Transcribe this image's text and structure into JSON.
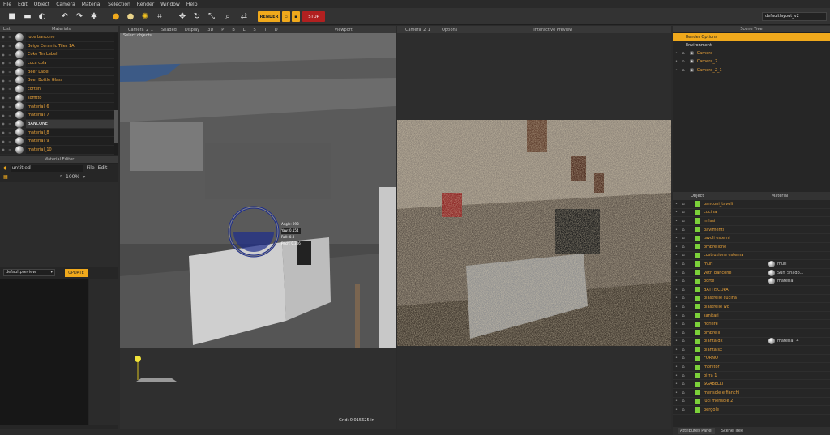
{
  "menu": [
    "File",
    "Edit",
    "Object",
    "Camera",
    "Material",
    "Selection",
    "Render",
    "Window",
    "Help"
  ],
  "toolbar": {
    "render_label": "RENDER",
    "stop_label": "STOP",
    "layout": "defaultlayout_v2"
  },
  "materials_panel": {
    "tabs": [
      "List",
      "Materials"
    ],
    "items": [
      {
        "name": "luce bancone",
        "sel": false
      },
      {
        "name": "Beige Ceramic Tiles 1A",
        "sel": false
      },
      {
        "name": "Coke Tin Label",
        "sel": false
      },
      {
        "name": "coca cola",
        "sel": false
      },
      {
        "name": "Beer Label",
        "sel": false
      },
      {
        "name": "Beer Bottle Glass",
        "sel": false
      },
      {
        "name": "corten",
        "sel": false
      },
      {
        "name": "soffitto",
        "sel": false
      },
      {
        "name": "material_6",
        "sel": false
      },
      {
        "name": "material_7",
        "sel": false
      },
      {
        "name": "BANCONE",
        "sel": true
      },
      {
        "name": "material_8",
        "sel": false
      },
      {
        "name": "material_9",
        "sel": false
      },
      {
        "name": "material_10",
        "sel": false
      }
    ]
  },
  "material_editor": {
    "title": "Material Editor",
    "name": "untitled",
    "menu": [
      "File",
      "Edit"
    ],
    "zoom": "100%",
    "preview": "defaultpreview",
    "update_label": "UPDATE"
  },
  "viewport": {
    "title": "Viewport",
    "camera": "Camera_2_1",
    "menus": [
      "Shaded",
      "Display",
      "3D",
      "P",
      "B",
      "L",
      "S",
      "T",
      "D"
    ],
    "hint": "Select objects",
    "grid": "Grid: 0.015625 in",
    "gizmo": {
      "angle": "Angle: 298",
      "yaw": "Yaw: 0.154",
      "roll": "Roll: 0.0",
      "pitch": "Pitch: 0.306"
    }
  },
  "interactive": {
    "title": "Interactive Preview",
    "camera": "Camera_2_1",
    "options": "Options"
  },
  "scene_tree": {
    "title": "Scene Tree",
    "render_options": "Render Options",
    "environment": "Environment",
    "cameras": [
      "Camera",
      "Camera_2",
      "Camera_2_1"
    ],
    "col_object": "Object",
    "col_material": "Material",
    "objects": [
      {
        "name": "banconi_tavoli",
        "mat": ""
      },
      {
        "name": "cucina",
        "mat": ""
      },
      {
        "name": "infissi",
        "mat": ""
      },
      {
        "name": "pavimenti",
        "mat": ""
      },
      {
        "name": "tavoli esterni",
        "mat": ""
      },
      {
        "name": "ombrellone",
        "mat": ""
      },
      {
        "name": "costruzione esterna",
        "mat": ""
      },
      {
        "name": "muri",
        "mat": "muri"
      },
      {
        "name": "vetri bancone",
        "mat": "Sun_Shado..."
      },
      {
        "name": "porte",
        "mat": "material"
      },
      {
        "name": "BATTISCOPA",
        "mat": ""
      },
      {
        "name": "piastrelle cucina",
        "mat": ""
      },
      {
        "name": "piastrelle wc",
        "mat": ""
      },
      {
        "name": "sanitari",
        "mat": ""
      },
      {
        "name": "fioriere",
        "mat": ""
      },
      {
        "name": "ombrelli",
        "mat": ""
      },
      {
        "name": "pianta dx",
        "mat": "material_4"
      },
      {
        "name": "pianta sx",
        "mat": ""
      },
      {
        "name": "FORNO",
        "mat": ""
      },
      {
        "name": "monitor",
        "mat": ""
      },
      {
        "name": "birra 1",
        "mat": ""
      },
      {
        "name": "SGABELLI",
        "mat": ""
      },
      {
        "name": "mensole e fianchi",
        "mat": ""
      },
      {
        "name": "luci mensole 2",
        "mat": ""
      },
      {
        "name": "pergole",
        "mat": ""
      }
    ],
    "bottom_tabs": [
      "Attributes Panel",
      "Scene Tree"
    ]
  }
}
